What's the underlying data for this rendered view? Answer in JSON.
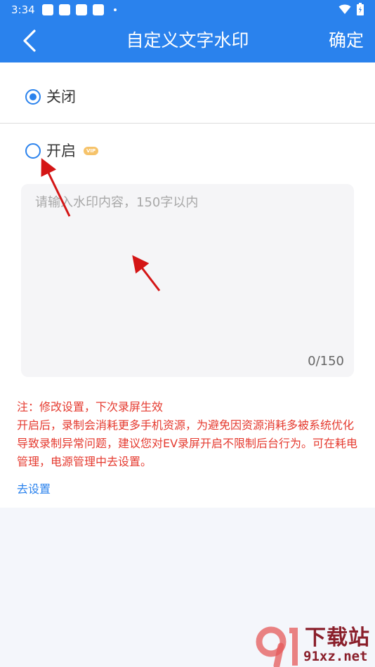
{
  "status_bar": {
    "time": "3:34",
    "wifi_icon": "wifi-icon",
    "battery_icon": "battery-charging-icon"
  },
  "header": {
    "title": "自定义文字水印",
    "back_icon": "chevron-left-icon",
    "confirm_label": "确定"
  },
  "options": {
    "off": {
      "label": "关闭",
      "selected": true
    },
    "on": {
      "label": "开启",
      "selected": false,
      "badge": "VIP"
    }
  },
  "textarea": {
    "placeholder": "请输入水印内容，150字以内",
    "value": "",
    "counter": "0/150"
  },
  "notice": {
    "line1": "注：修改设置，下次录屏生效",
    "line2": "开启后，录制会消耗更多手机资源，为避免因资源消耗多被系统优化导致录制异常问题，建议您对EV录屏开启不限制后台行为。可在耗电管理，电源管理中去设置。"
  },
  "settings_link": "去设置",
  "watermark": {
    "text_top": "下载站",
    "text_bottom": "91xz.net"
  },
  "colors": {
    "accent": "#2a82ed",
    "warning": "#e53a2f",
    "annotation_arrow": "#d41515"
  }
}
